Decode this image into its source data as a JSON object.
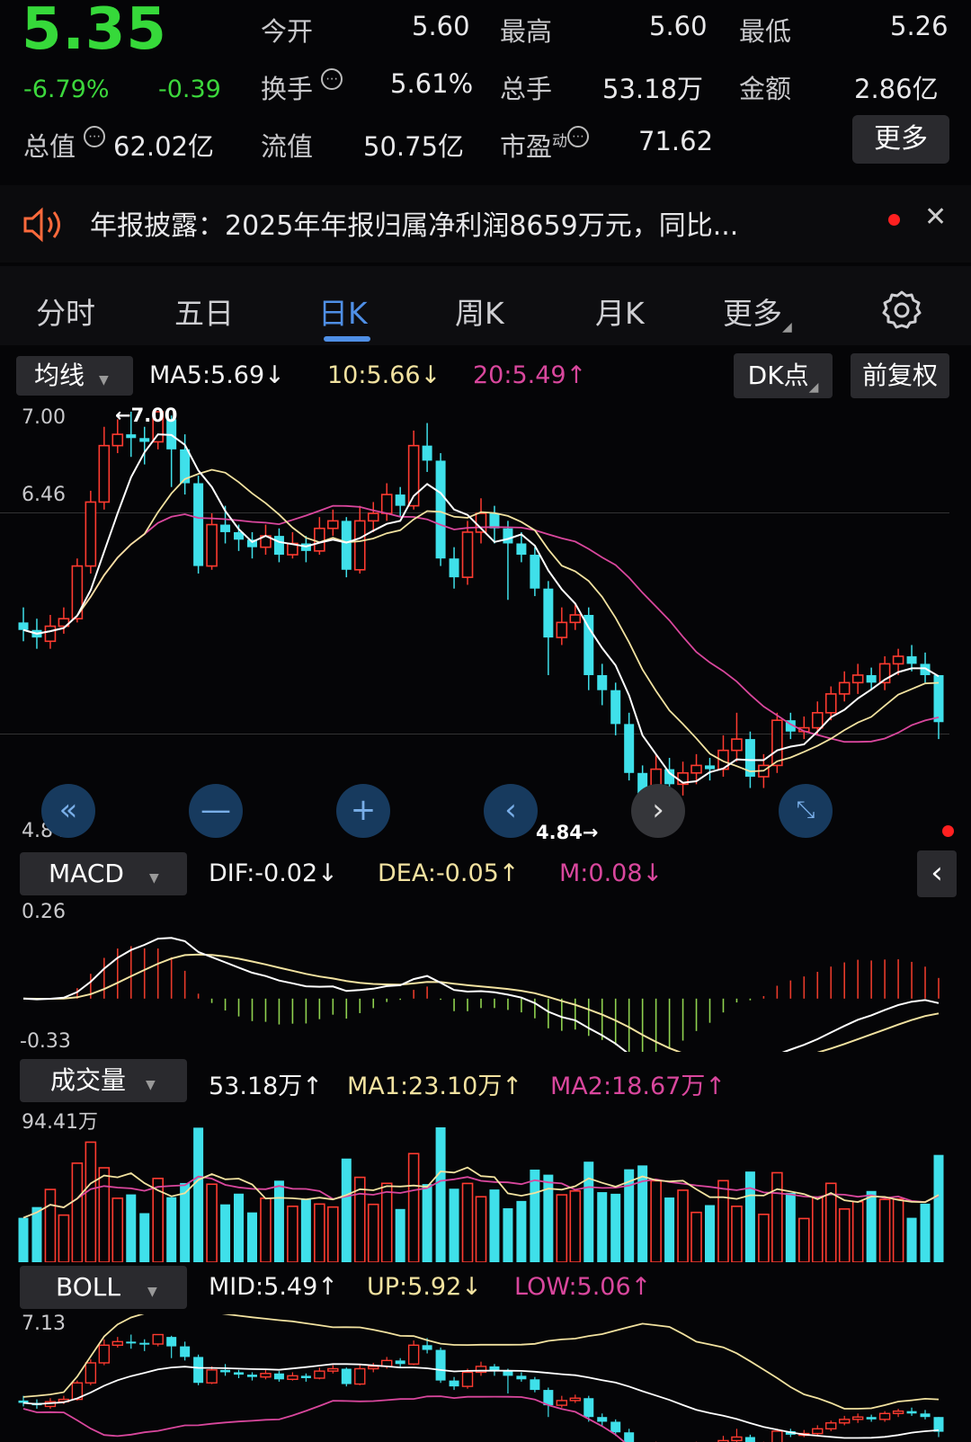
{
  "quote": {
    "price": "5.35",
    "change_pct": "-6.79%",
    "change_abs": "-0.39",
    "open_label": "今开",
    "open": "5.60",
    "high_label": "最高",
    "high": "5.60",
    "low_label": "最低",
    "low": "5.26",
    "turnover_label": "换手",
    "turnover": "5.61%",
    "volume_label": "总手",
    "volume": "53.18万",
    "amount_label": "金额",
    "amount": "2.86亿",
    "mktcap_label": "总值",
    "mktcap": "62.02亿",
    "float_label": "流值",
    "float": "50.75亿",
    "pe_label": "市盈",
    "pe_sup": "动",
    "pe": "71.62",
    "more_button": "更多",
    "colors": {
      "down": "#36d93a",
      "up": "#ff3b30"
    }
  },
  "notice": {
    "icon": "speaker-icon",
    "text": "年报披露：2025年年报归属净利润8659万元，同比...",
    "close_icon": "close-icon"
  },
  "tabs": {
    "items": [
      "分时",
      "五日",
      "日K",
      "周K",
      "月K",
      "更多"
    ],
    "active": "日K",
    "settings_icon": "gear-icon"
  },
  "kline": {
    "ma_selector": "均线",
    "ma5": "MA5:5.69↓",
    "ma10": "10:5.66↓",
    "ma20": "20:5.49↑",
    "dk_button": "DK点",
    "adjust_button": "前复权",
    "y_top": "7.00",
    "y_mid": "6.46",
    "y_bottom": "4.84",
    "high_marker": "←7.00",
    "low_marker": "4.84→",
    "colors": {
      "up": "#ff3b30",
      "down": "#3fe0ea",
      "ma5": "#ffffff",
      "ma10": "#f2e2a0",
      "ma20": "#d9479d"
    }
  },
  "nav": {
    "icons": [
      "double-left-icon",
      "zoom-out-icon",
      "zoom-in-icon",
      "prev-icon",
      "next-icon",
      "fullscreen-icon"
    ]
  },
  "macd": {
    "selector": "MACD",
    "dif": "DIF:-0.02↓",
    "dea": "DEA:-0.05↑",
    "m": "M:0.08↓",
    "y_top": "0.26",
    "y_bottom": "-0.33"
  },
  "volume": {
    "selector": "成交量",
    "value": "53.18万↑",
    "ma1": "MA1:23.10万↑",
    "ma2": "MA2:18.67万↑",
    "y_top": "94.41万"
  },
  "boll": {
    "selector": "BOLL",
    "mid": "MID:5.49↑",
    "up": "UP:5.92↓",
    "low": "LOW:5.06↑",
    "y_top": "7.13"
  },
  "chart_data": {
    "type": "candlestick",
    "price_range": [
      4.84,
      7.0
    ],
    "candles": [
      [
        5.88,
        5.84,
        5.96,
        5.78
      ],
      [
        5.84,
        5.8,
        5.9,
        5.74
      ],
      [
        5.78,
        5.86,
        5.92,
        5.74
      ],
      [
        5.86,
        5.9,
        5.96,
        5.82
      ],
      [
        5.9,
        6.18,
        6.22,
        5.88
      ],
      [
        6.18,
        6.52,
        6.58,
        6.14
      ],
      [
        6.52,
        6.82,
        6.92,
        6.48
      ],
      [
        6.82,
        6.88,
        6.96,
        6.78
      ],
      [
        6.88,
        6.86,
        7.0,
        6.76
      ],
      [
        6.86,
        6.84,
        6.92,
        6.72
      ],
      [
        6.84,
        7.0,
        7.0,
        6.8
      ],
      [
        6.96,
        6.8,
        6.98,
        6.6
      ],
      [
        6.8,
        6.62,
        6.88,
        6.56
      ],
      [
        6.62,
        6.18,
        6.66,
        6.14
      ],
      [
        6.18,
        6.4,
        6.46,
        6.16
      ],
      [
        6.4,
        6.36,
        6.5,
        6.3
      ],
      [
        6.36,
        6.32,
        6.4,
        6.26
      ],
      [
        6.32,
        6.28,
        6.36,
        6.22
      ],
      [
        6.28,
        6.34,
        6.4,
        6.24
      ],
      [
        6.34,
        6.24,
        6.38,
        6.2
      ],
      [
        6.24,
        6.3,
        6.36,
        6.22
      ],
      [
        6.3,
        6.26,
        6.34,
        6.2
      ],
      [
        6.26,
        6.38,
        6.44,
        6.24
      ],
      [
        6.38,
        6.42,
        6.48,
        6.34
      ],
      [
        6.42,
        6.16,
        6.44,
        6.12
      ],
      [
        6.16,
        6.42,
        6.5,
        6.14
      ],
      [
        6.42,
        6.46,
        6.52,
        6.36
      ],
      [
        6.46,
        6.56,
        6.62,
        6.42
      ],
      [
        6.56,
        6.5,
        6.6,
        6.44
      ],
      [
        6.5,
        6.82,
        6.9,
        6.48
      ],
      [
        6.82,
        6.74,
        6.94,
        6.68
      ],
      [
        6.74,
        6.22,
        6.78,
        6.18
      ],
      [
        6.22,
        6.12,
        6.28,
        6.06
      ],
      [
        6.12,
        6.36,
        6.42,
        6.08
      ],
      [
        6.36,
        6.46,
        6.54,
        6.3
      ],
      [
        6.46,
        6.38,
        6.5,
        6.3
      ],
      [
        6.38,
        6.3,
        6.42,
        6.0
      ],
      [
        6.3,
        6.24,
        6.36,
        6.2
      ],
      [
        6.24,
        6.06,
        6.28,
        6.02
      ],
      [
        6.06,
        5.8,
        6.1,
        5.6
      ],
      [
        5.8,
        5.88,
        5.96,
        5.76
      ],
      [
        5.88,
        5.92,
        5.98,
        5.84
      ],
      [
        5.92,
        5.6,
        5.96,
        5.52
      ],
      [
        5.6,
        5.52,
        5.66,
        5.44
      ],
      [
        5.52,
        5.34,
        5.56,
        5.28
      ],
      [
        5.34,
        5.08,
        5.4,
        5.04
      ],
      [
        5.08,
        4.86,
        5.12,
        4.84
      ],
      [
        4.86,
        5.1,
        5.18,
        4.86
      ],
      [
        5.1,
        5.02,
        5.16,
        4.98
      ],
      [
        5.02,
        5.08,
        5.14,
        4.96
      ],
      [
        5.08,
        5.12,
        5.18,
        5.02
      ],
      [
        5.12,
        5.1,
        5.16,
        5.04
      ],
      [
        5.1,
        5.2,
        5.28,
        5.06
      ],
      [
        5.2,
        5.26,
        5.4,
        5.14
      ],
      [
        5.26,
        5.06,
        5.3,
        5.0
      ],
      [
        5.06,
        5.12,
        5.18,
        5.0
      ],
      [
        5.12,
        5.36,
        5.4,
        5.08
      ],
      [
        5.36,
        5.3,
        5.4,
        5.26
      ],
      [
        5.3,
        5.32,
        5.38,
        5.26
      ],
      [
        5.32,
        5.4,
        5.46,
        5.28
      ],
      [
        5.4,
        5.5,
        5.54,
        5.36
      ],
      [
        5.5,
        5.56,
        5.62,
        5.46
      ],
      [
        5.56,
        5.6,
        5.66,
        5.5
      ],
      [
        5.6,
        5.56,
        5.64,
        5.52
      ],
      [
        5.56,
        5.66,
        5.7,
        5.52
      ],
      [
        5.66,
        5.7,
        5.74,
        5.6
      ],
      [
        5.7,
        5.66,
        5.76,
        5.62
      ],
      [
        5.66,
        5.6,
        5.72,
        5.56
      ],
      [
        5.6,
        5.35,
        5.6,
        5.26
      ]
    ]
  }
}
